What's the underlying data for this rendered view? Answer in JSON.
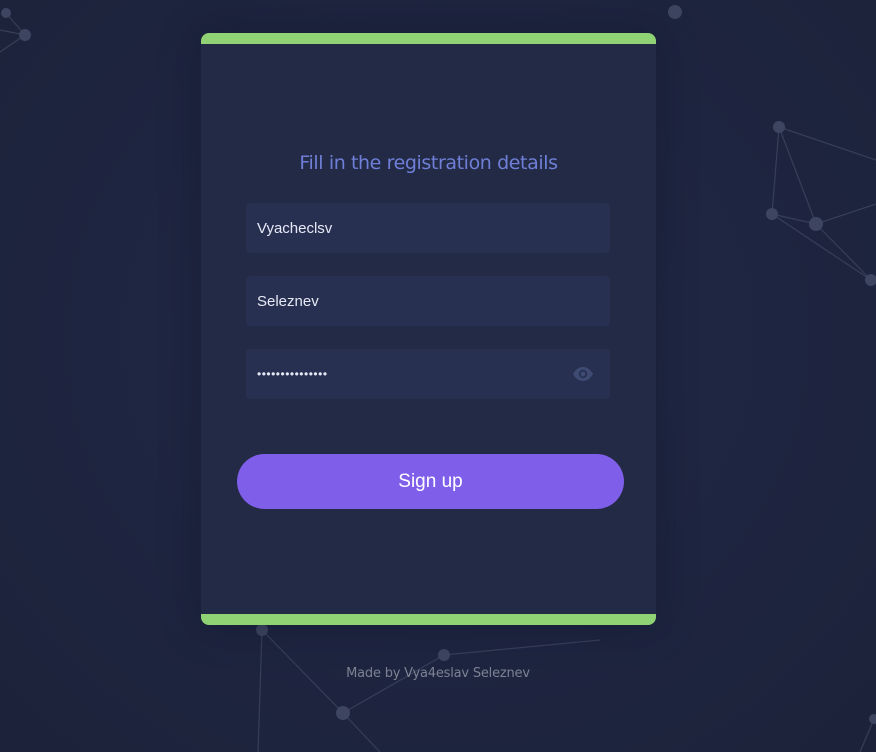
{
  "form": {
    "title": "Fill in the registration details",
    "first_name_value": "Vyacheclsv",
    "last_name_value": "Seleznev",
    "password_masked": "•••••••••••••••",
    "password_toggle_icon": "eye-icon",
    "signup_label": "Sign up"
  },
  "footer": {
    "credit": "Made by Vya4eslav Seleznev"
  },
  "colors": {
    "background": "#1f2640",
    "card": "#232a45",
    "accent_stripe": "#8fd374",
    "title": "#6f7fd8",
    "field": "#283052",
    "button": "#7f5fea"
  }
}
